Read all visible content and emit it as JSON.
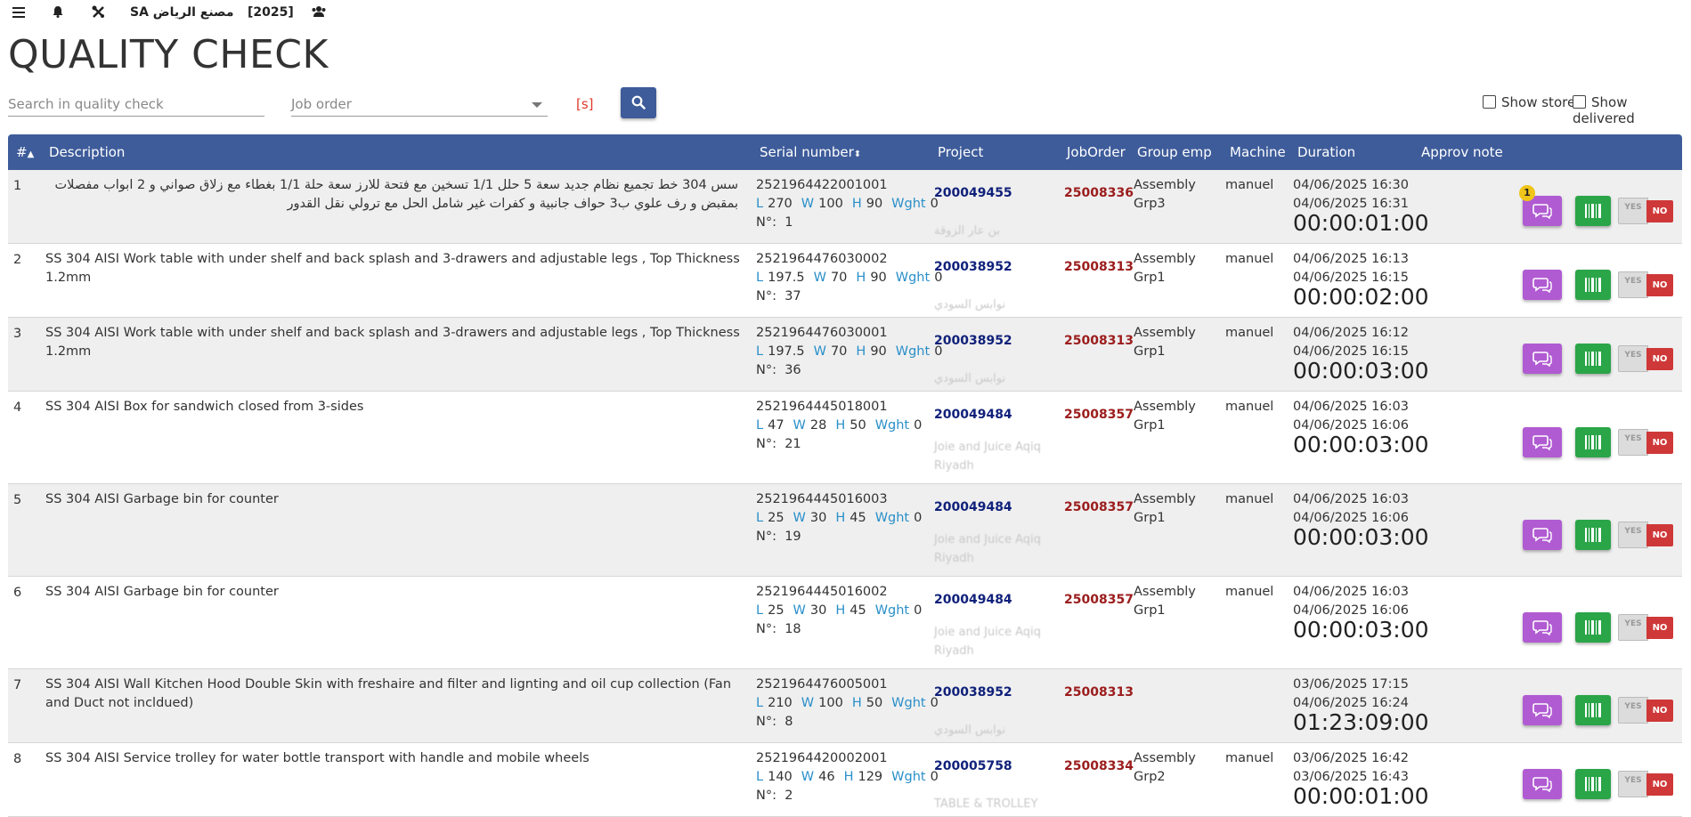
{
  "topbar": {
    "company": "SA مصنع الرياض",
    "year": "[2025]"
  },
  "page_title": "QUALITY CHECK",
  "search": {
    "placeholder": "Search in quality check",
    "value": ""
  },
  "joborder_select": {
    "placeholder": "Job order",
    "value": ""
  },
  "shortcut_hint": "[s]",
  "filters": {
    "show_store_label": "Show store",
    "show_delivered_label": "Show delivered"
  },
  "columns": {
    "num": "#",
    "description": "Description",
    "serial": "Serial number",
    "project": "Project",
    "joborder": "JobOrder",
    "group": "Group emp",
    "machine": "Machine",
    "duration": "Duration",
    "approv": "Approv note"
  },
  "dim_labels": {
    "l": "L",
    "w": "W",
    "h": "H",
    "wght": "Wght",
    "nr": "N°:"
  },
  "toggle": {
    "yes": "YES",
    "no": "NO"
  },
  "rows": [
    {
      "num": "1",
      "description": "سس 304 خط تجميع نظام جديد سعة 5 حلل 1/1 تسخين مع فتحة للارز سعة حلة 1/1 بغطاء مع زلاق صواني و 2 ابواب مفصلات بمقبض و رف علوي ب3 حواف جانبية و كفرات غير شامل الحل مع ترولي نقل القدور",
      "rtl": true,
      "serial": "2521964422001001",
      "l": "270",
      "w": "100",
      "h": "90",
      "wght": "0",
      "nr": "1",
      "project": "200049455",
      "project_name": "بن عار الزوقة",
      "joborder": "25008336",
      "group": "Assembly Grp3",
      "machine": "manuel",
      "start": "04/06/2025 16:30",
      "end": "04/06/2025 16:31",
      "duration": "00:00:01:00",
      "note_count": "1"
    },
    {
      "num": "2",
      "description": "SS 304 AISI Work table with under shelf and back splash and 3-drawers and adjustable legs , Top Thickness 1.2mm",
      "rtl": false,
      "serial": "2521964476030002",
      "l": "197.5",
      "w": "70",
      "h": "90",
      "wght": "0",
      "nr": "37",
      "project": "200038952",
      "project_name": "نوابس السودي",
      "joborder": "25008313",
      "group": "Assembly Grp1",
      "machine": "manuel",
      "start": "04/06/2025 16:13",
      "end": "04/06/2025 16:15",
      "duration": "00:00:02:00",
      "note_count": ""
    },
    {
      "num": "3",
      "description": "SS 304 AISI Work table with under shelf and back splash and 3-drawers and adjustable legs , Top Thickness 1.2mm",
      "rtl": false,
      "serial": "2521964476030001",
      "l": "197.5",
      "w": "70",
      "h": "90",
      "wght": "0",
      "nr": "36",
      "project": "200038952",
      "project_name": "نوابس السودي",
      "joborder": "25008313",
      "group": "Assembly Grp1",
      "machine": "manuel",
      "start": "04/06/2025 16:12",
      "end": "04/06/2025 16:15",
      "duration": "00:00:03:00",
      "note_count": ""
    },
    {
      "num": "4",
      "description": "SS 304 AISI Box for sandwich closed from 3-sides",
      "rtl": false,
      "serial": "2521964445018001",
      "l": "47",
      "w": "28",
      "h": "50",
      "wght": "0",
      "nr": "21",
      "project": "200049484",
      "project_name": "Joie and Juice Aqiq Riyadh",
      "joborder": "25008357",
      "group": "Assembly Grp1",
      "machine": "manuel",
      "start": "04/06/2025 16:03",
      "end": "04/06/2025 16:06",
      "duration": "00:00:03:00",
      "note_count": ""
    },
    {
      "num": "5",
      "description": "SS 304 AISI Garbage bin for counter",
      "rtl": false,
      "serial": "2521964445016003",
      "l": "25",
      "w": "30",
      "h": "45",
      "wght": "0",
      "nr": "19",
      "project": "200049484",
      "project_name": "Joie and Juice Aqiq Riyadh",
      "joborder": "25008357",
      "group": "Assembly Grp1",
      "machine": "manuel",
      "start": "04/06/2025 16:03",
      "end": "04/06/2025 16:06",
      "duration": "00:00:03:00",
      "note_count": ""
    },
    {
      "num": "6",
      "description": "SS 304 AISI Garbage bin for counter",
      "rtl": false,
      "serial": "2521964445016002",
      "l": "25",
      "w": "30",
      "h": "45",
      "wght": "0",
      "nr": "18",
      "project": "200049484",
      "project_name": "Joie and Juice Aqiq Riyadh",
      "joborder": "25008357",
      "group": "Assembly Grp1",
      "machine": "manuel",
      "start": "04/06/2025 16:03",
      "end": "04/06/2025 16:06",
      "duration": "00:00:03:00",
      "note_count": ""
    },
    {
      "num": "7",
      "description": "SS 304 AISI Wall Kitchen Hood Double Skin with freshaire and filter and lignting and oil cup collection (Fan and Duct not incldued)",
      "rtl": false,
      "serial": "2521964476005001",
      "l": "210",
      "w": "100",
      "h": "50",
      "wght": "0",
      "nr": "8",
      "project": "200038952",
      "project_name": "نوابس السودي",
      "joborder": "25008313",
      "group": "",
      "machine": "",
      "start": "03/06/2025 17:15",
      "end": "04/06/2025 16:24",
      "duration": "01:23:09:00",
      "note_count": ""
    },
    {
      "num": "8",
      "description": "SS 304 AISI Service trolley for water bottle transport with handle and mobile wheels",
      "rtl": false,
      "serial": "2521964420002001",
      "l": "140",
      "w": "46",
      "h": "129",
      "wght": "0",
      "nr": "2",
      "project": "200005758",
      "project_name": "TABLE & TROLLEY",
      "joborder": "25008334",
      "group": "Assembly Grp2",
      "machine": "manuel",
      "start": "03/06/2025 16:42",
      "end": "03/06/2025 16:43",
      "duration": "00:00:01:00",
      "note_count": ""
    }
  ]
}
